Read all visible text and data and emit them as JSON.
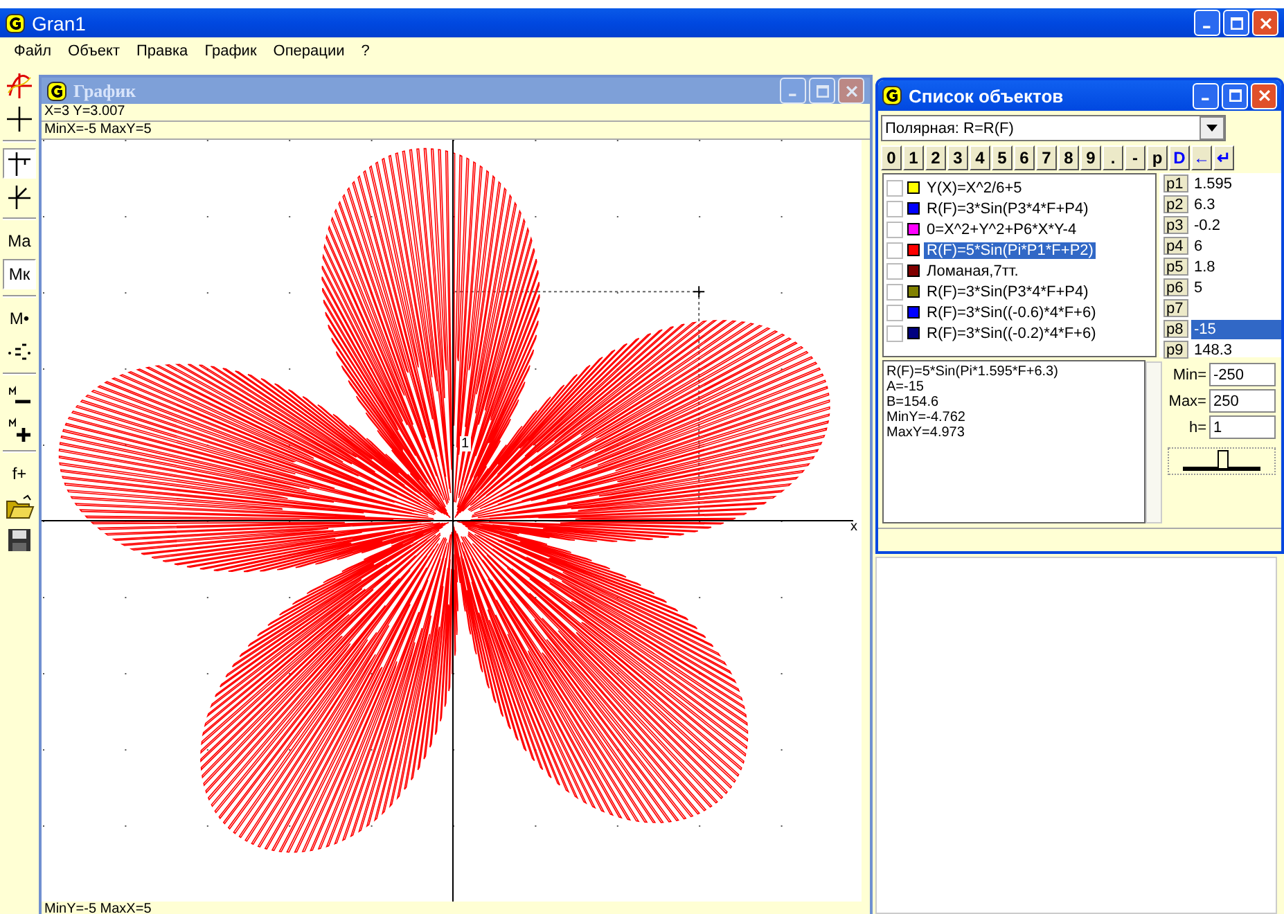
{
  "window": {
    "title": "Gran1"
  },
  "menu": [
    "Файл",
    "Объект",
    "Правка",
    "График",
    "Операции",
    "?"
  ],
  "toolbar": [
    {
      "kind": "curve",
      "selected": false
    },
    {
      "kind": "plus",
      "selected": false
    },
    {
      "kind": "sep"
    },
    {
      "kind": "cross",
      "selected": true
    },
    {
      "kind": "slant",
      "selected": false
    },
    {
      "kind": "sep"
    },
    {
      "kind": "text",
      "label": "Ma",
      "selected": false
    },
    {
      "kind": "text",
      "label": "Mк",
      "selected": true
    },
    {
      "kind": "sep"
    },
    {
      "kind": "text",
      "label": "M•",
      "selected": false
    },
    {
      "kind": "dots",
      "selected": false
    },
    {
      "kind": "sep"
    },
    {
      "kind": "mminus",
      "selected": false
    },
    {
      "kind": "mplus",
      "selected": false
    },
    {
      "kind": "sep"
    },
    {
      "kind": "text",
      "label": "f+",
      "selected": false
    },
    {
      "kind": "folder",
      "selected": false
    },
    {
      "kind": "save",
      "selected": false
    }
  ],
  "graph_window": {
    "title": "График",
    "cursor": "X=3 Y=3.007",
    "top_range": "MinX=-5  MaxY=5",
    "bottom_range": "MinY=-5  MaxX=5",
    "x_axis_label": "x",
    "y_tick_label": "1"
  },
  "object_window": {
    "title": "Список объектов",
    "curve_type": "Полярная: R=R(F)",
    "keys": [
      {
        "label": "0",
        "color": "#000000"
      },
      {
        "label": "1",
        "color": "#000000"
      },
      {
        "label": "2",
        "color": "#000000"
      },
      {
        "label": "3",
        "color": "#000000"
      },
      {
        "label": "4",
        "color": "#000000"
      },
      {
        "label": "5",
        "color": "#000000"
      },
      {
        "label": "6",
        "color": "#000000"
      },
      {
        "label": "7",
        "color": "#000000"
      },
      {
        "label": "8",
        "color": "#000000"
      },
      {
        "label": "9",
        "color": "#000000"
      },
      {
        "label": ".",
        "color": "#000000"
      },
      {
        "label": "-",
        "color": "#000000"
      },
      {
        "label": "p",
        "color": "#000000"
      },
      {
        "label": "D",
        "color": "#0000ff"
      },
      {
        "label": "←",
        "color": "#0000ff"
      },
      {
        "label": "↵",
        "color": "#0000ff"
      }
    ],
    "objects": [
      {
        "label": "Y(X)=X^2/6+5",
        "color": "#ffff00",
        "checked": false,
        "selected": false
      },
      {
        "label": "R(F)=3*Sin(P3*4*F+P4)",
        "color": "#0000ff",
        "checked": false,
        "selected": false
      },
      {
        "label": "0=X^2+Y^2+P6*X*Y-4",
        "color": "#ff00ff",
        "checked": false,
        "selected": false
      },
      {
        "label": "R(F)=5*Sin(Pi*P1*F+P2)",
        "color": "#ff0000",
        "checked": false,
        "selected": true
      },
      {
        "label": "Ломаная,7тт.",
        "color": "#800000",
        "checked": false,
        "selected": false
      },
      {
        "label": "R(F)=3*Sin(P3*4*F+P4)",
        "color": "#808000",
        "checked": false,
        "selected": false
      },
      {
        "label": "R(F)=3*Sin((-0.6)*4*F+6)",
        "color": "#0000ff",
        "checked": false,
        "selected": false
      },
      {
        "label": "R(F)=3*Sin((-0.2)*4*F+6)",
        "color": "#000080",
        "checked": false,
        "selected": false
      }
    ],
    "params": [
      {
        "name": "p1",
        "value": "1.595",
        "selected": false
      },
      {
        "name": "p2",
        "value": "6.3",
        "selected": false
      },
      {
        "name": "p3",
        "value": "-0.2",
        "selected": false
      },
      {
        "name": "p4",
        "value": "6",
        "selected": false
      },
      {
        "name": "p5",
        "value": "1.8",
        "selected": false
      },
      {
        "name": "p6",
        "value": "5",
        "selected": false
      },
      {
        "name": "p7",
        "selected": false
      },
      {
        "name": "p8",
        "value": "-15",
        "selected": true
      },
      {
        "name": "p9",
        "value": "148.3",
        "selected": false
      }
    ],
    "info": [
      "R(F)=5*Sin(Pi*1.595*F+6.3)",
      "A=-15",
      "B=154.6",
      "MinY=-4.762",
      "MaxY=4.973"
    ],
    "range": [
      {
        "label": "Min=",
        "value": "-250"
      },
      {
        "label": "Max=",
        "value": "250"
      },
      {
        "label": "h=",
        "value": "1"
      }
    ],
    "slider": {
      "level": 0.5
    }
  }
}
